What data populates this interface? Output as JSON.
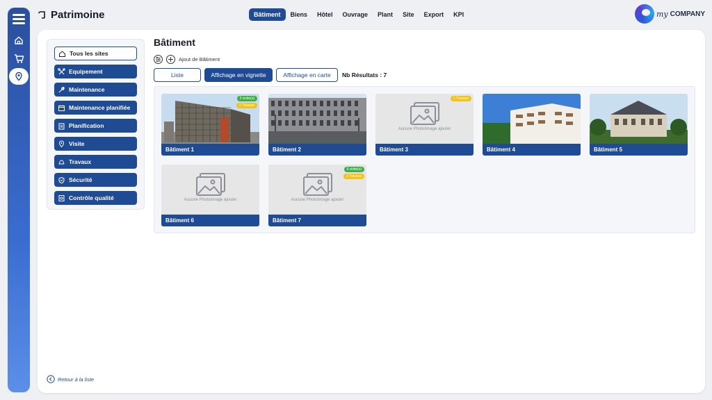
{
  "header": {
    "title": "Patrimoine"
  },
  "topnav": [
    "Bâtiment",
    "Biens",
    "Hôtel",
    "Ouvrage",
    "Plant",
    "Site",
    "Export",
    "KPI"
  ],
  "logo": {
    "my": "my",
    "company": "COMPANY"
  },
  "sidebar": {
    "items": [
      {
        "label": "Tous les sites",
        "icon": "home-icon"
      },
      {
        "label": "Equipement",
        "icon": "tools-icon"
      },
      {
        "label": "Maintenance",
        "icon": "wrench-icon"
      },
      {
        "label": "Maintenance planifiée",
        "icon": "calendar-icon"
      },
      {
        "label": "Planification",
        "icon": "clipboard-icon"
      },
      {
        "label": "Visite",
        "icon": "location-icon"
      },
      {
        "label": "Travaux",
        "icon": "helmet-icon"
      },
      {
        "label": "Sécurité",
        "icon": "shield-icon"
      },
      {
        "label": "Contrôle qualité",
        "icon": "quality-icon"
      }
    ]
  },
  "back_link": "Retour à la liste",
  "content": {
    "title": "Bâtiment",
    "add_label": "Ajout de Bâtiment",
    "views": [
      "Liste",
      "Affichage en vignette",
      "Affichage en carte"
    ],
    "results": "Nb Résultats : 7",
    "no_photo": "Aucune Photo/image ajouter",
    "cards": [
      {
        "label": "Bâtiment 1",
        "photo": true,
        "badges": [
          {
            "text": "2 visite(s)",
            "color": "green"
          },
          {
            "text": "1 Travaux",
            "color": "yellow"
          }
        ]
      },
      {
        "label": "Bâtiment 2",
        "photo": true,
        "badges": []
      },
      {
        "label": "Bâtiment 3",
        "photo": false,
        "badges": [
          {
            "text": "1 Travaux",
            "color": "yellow"
          }
        ]
      },
      {
        "label": "Bâtiment 4",
        "photo": true,
        "badges": []
      },
      {
        "label": "Bâtiment 5",
        "photo": true,
        "badges": []
      },
      {
        "label": "Bâtiment 6",
        "photo": false,
        "badges": []
      },
      {
        "label": "Bâtiment 7",
        "photo": false,
        "badges": [
          {
            "text": "6 visite(s)",
            "color": "green"
          },
          {
            "text": "2 Travaux",
            "color": "yellow"
          }
        ]
      }
    ]
  },
  "colors": {
    "primary": "#1f4b94",
    "badge_green": "#3fae49",
    "badge_yellow": "#f2c21a"
  }
}
